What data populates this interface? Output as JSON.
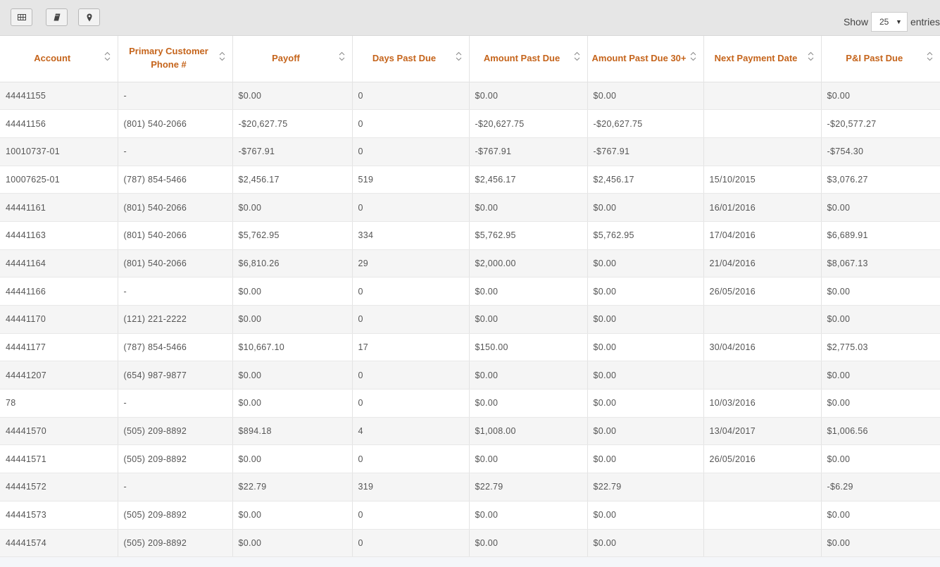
{
  "toolbar": {
    "buttons": [
      {
        "icon": "table-grid-icon"
      },
      {
        "icon": "book-icon"
      },
      {
        "icon": "map-pin-icon"
      }
    ],
    "show_label": "Show",
    "page_size": "25",
    "entries_label": "entries"
  },
  "table": {
    "headers": [
      "Account",
      "Primary Customer Phone #",
      "Payoff",
      "Days Past Due",
      "Amount Past Due",
      "Amount Past Due 30+",
      "Next Payment Date",
      "P&I Past Due"
    ],
    "rows": [
      [
        "44441155",
        "-",
        "$0.00",
        "0",
        "$0.00",
        "$0.00",
        "",
        "$0.00"
      ],
      [
        "44441156",
        "(801) 540-2066",
        "-$20,627.75",
        "0",
        "-$20,627.75",
        "-$20,627.75",
        "",
        "-$20,577.27"
      ],
      [
        "10010737-01",
        "-",
        "-$767.91",
        "0",
        "-$767.91",
        "-$767.91",
        "",
        "-$754.30"
      ],
      [
        "10007625-01",
        "(787) 854-5466",
        "$2,456.17",
        "519",
        "$2,456.17",
        "$2,456.17",
        "15/10/2015",
        "$3,076.27"
      ],
      [
        "44441161",
        "(801) 540-2066",
        "$0.00",
        "0",
        "$0.00",
        "$0.00",
        "16/01/2016",
        "$0.00"
      ],
      [
        "44441163",
        "(801) 540-2066",
        "$5,762.95",
        "334",
        "$5,762.95",
        "$5,762.95",
        "17/04/2016",
        "$6,689.91"
      ],
      [
        "44441164",
        "(801) 540-2066",
        "$6,810.26",
        "29",
        "$2,000.00",
        "$0.00",
        "21/04/2016",
        "$8,067.13"
      ],
      [
        "44441166",
        "-",
        "$0.00",
        "0",
        "$0.00",
        "$0.00",
        "26/05/2016",
        "$0.00"
      ],
      [
        "44441170",
        "(121) 221-2222",
        "$0.00",
        "0",
        "$0.00",
        "$0.00",
        "",
        "$0.00"
      ],
      [
        "44441177",
        "(787) 854-5466",
        "$10,667.10",
        "17",
        "$150.00",
        "$0.00",
        "30/04/2016",
        "$2,775.03"
      ],
      [
        "44441207",
        "(654) 987-9877",
        "$0.00",
        "0",
        "$0.00",
        "$0.00",
        "",
        "$0.00"
      ],
      [
        "78",
        "-",
        "$0.00",
        "0",
        "$0.00",
        "$0.00",
        "10/03/2016",
        "$0.00"
      ],
      [
        "44441570",
        "(505) 209-8892",
        "$894.18",
        "4",
        "$1,008.00",
        "$0.00",
        "13/04/2017",
        "$1,006.56"
      ],
      [
        "44441571",
        "(505) 209-8892",
        "$0.00",
        "0",
        "$0.00",
        "$0.00",
        "26/05/2016",
        "$0.00"
      ],
      [
        "44441572",
        "-",
        "$22.79",
        "319",
        "$22.79",
        "$22.79",
        "",
        "-$6.29"
      ],
      [
        "44441573",
        "(505) 209-8892",
        "$0.00",
        "0",
        "$0.00",
        "$0.00",
        "",
        "$0.00"
      ],
      [
        "44441574",
        "(505) 209-8892",
        "$0.00",
        "0",
        "$0.00",
        "$0.00",
        "",
        "$0.00"
      ]
    ]
  },
  "colors": {
    "header_text": "#c5641b",
    "toolbar_bg": "#e6e6e6",
    "row_stripe": "#f5f5f5"
  }
}
